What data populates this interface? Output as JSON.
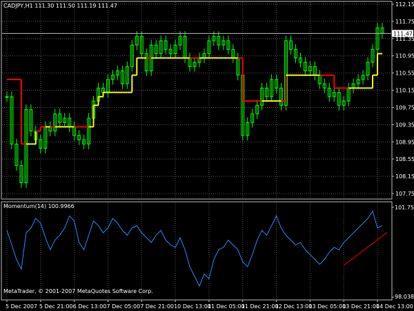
{
  "header": {
    "symbol": "CADJPY,H1",
    "ohlc": "111.30 111.50 111.19 111.47"
  },
  "indicator": {
    "name": "Momentum(14)",
    "value": "100.9966"
  },
  "copyright": "MetaTrader, © 2001-2007 MetaQuotes Software Corp.",
  "colors": {
    "background": "#000000",
    "grid": "#5a5a5a",
    "frame": "#c0c0c0",
    "candles": "#00ff00",
    "line_up": "#ffff00",
    "line_down": "#ff0000",
    "momentum": "#1e90ff",
    "trendline": "#ff0000"
  },
  "chart_data": [
    {
      "type": "line",
      "panel": "price",
      "y_ticks": [
        "112.15",
        "111.75",
        "111.35",
        "110.95",
        "110.55",
        "110.15",
        "109.75",
        "109.35",
        "108.95",
        "108.55",
        "108.15",
        "107.75"
      ],
      "ylim": [
        107.75,
        112.15
      ],
      "current_price": "111.47",
      "x_ticks": [
        "5 Dec 2007",
        "5 Dec 21:00",
        "6 Dec 13:00",
        "7 Dec 05:00",
        "7 Dec 21:00",
        "10 Dec 13:00",
        "11 Dec 05:00",
        "11 Dec 21:00",
        "12 Dec 13:00",
        "13 Dec 05:00",
        "13 Dec 21:00",
        "14 Dec 13:00"
      ],
      "price_close": [
        110.0,
        108.9,
        108.4,
        108.0,
        109.7,
        109.2,
        109.0,
        108.8,
        109.3,
        109.2,
        109.6,
        109.4,
        109.5,
        109.3,
        109.1,
        109.0,
        108.9,
        109.5,
        109.9,
        110.2,
        110.1,
        110.4,
        110.5,
        110.6,
        110.3,
        110.7,
        111.2,
        111.4,
        111.0,
        110.6,
        111.2,
        111.0,
        111.3,
        111.1,
        111.0,
        111.2,
        111.4,
        110.9,
        110.7,
        110.8,
        110.9,
        111.0,
        111.3,
        111.4,
        111.2,
        111.3,
        111.1,
        110.9,
        110.5,
        109.1,
        109.4,
        109.6,
        109.8,
        110.2,
        110.0,
        110.4,
        110.2,
        109.8,
        111.3,
        111.1,
        110.9,
        110.8,
        110.6,
        110.7,
        110.5,
        110.3,
        110.2,
        110.0,
        110.1,
        109.8,
        109.9,
        110.2,
        110.3,
        110.4,
        110.5,
        110.8,
        111.1,
        111.6,
        111.47
      ],
      "support_line": [
        110.4,
        110.4,
        110.4,
        108.9,
        108.9,
        108.9,
        109.2,
        109.3,
        109.3,
        109.3,
        109.3,
        109.3,
        109.3,
        109.3,
        109.3,
        109.3,
        109.3,
        109.3,
        109.8,
        110.0,
        110.1,
        110.1,
        110.1,
        110.1,
        110.1,
        110.1,
        110.5,
        110.9,
        110.9,
        110.9,
        110.9,
        110.9,
        110.9,
        110.9,
        110.9,
        110.9,
        110.9,
        110.9,
        110.9,
        110.9,
        110.9,
        110.9,
        110.9,
        110.9,
        110.9,
        110.9,
        110.9,
        110.9,
        110.9,
        109.9,
        109.9,
        109.9,
        109.9,
        109.9,
        109.9,
        109.9,
        109.9,
        109.9,
        110.5,
        110.5,
        110.5,
        110.5,
        110.5,
        110.5,
        110.5,
        110.5,
        110.5,
        110.5,
        110.2,
        110.2,
        110.2,
        110.2,
        110.2,
        110.2,
        110.2,
        110.2,
        110.5,
        111.0,
        111.0
      ],
      "x_tick_positions": [
        0,
        7,
        14,
        21,
        28,
        35,
        42,
        49,
        56,
        63,
        70,
        77
      ]
    },
    {
      "type": "line",
      "panel": "momentum",
      "series_name": "Momentum(14)",
      "y_ticks": [
        "101.7566",
        "98.0383"
      ],
      "ylim": [
        98.0383,
        101.7566
      ],
      "values": [
        100.8,
        100.2,
        99.6,
        99.2,
        100.7,
        100.9,
        101.3,
        101.1,
        100.5,
        100.0,
        100.4,
        100.6,
        100.9,
        101.4,
        101.2,
        100.3,
        100.0,
        100.6,
        101.2,
        101.0,
        100.7,
        100.9,
        101.3,
        101.1,
        100.8,
        100.6,
        100.9,
        101.0,
        100.7,
        100.5,
        100.3,
        100.6,
        100.8,
        100.4,
        100.2,
        100.1,
        100.5,
        100.0,
        99.3,
        98.9,
        98.5,
        99.0,
        98.8,
        99.6,
        100.0,
        100.1,
        100.4,
        100.2,
        100.0,
        99.5,
        99.3,
        99.8,
        100.4,
        100.8,
        100.6,
        101.0,
        101.4,
        100.9,
        100.6,
        100.4,
        100.2,
        100.3,
        100.0,
        99.8,
        99.6,
        99.4,
        99.6,
        99.9,
        100.1,
        100.0,
        100.3,
        100.5,
        100.7,
        100.9,
        101.1,
        101.3,
        101.6,
        100.9,
        101.0
      ],
      "trendline": [
        [
          70,
          99.35
        ],
        [
          79,
          100.72
        ]
      ]
    }
  ]
}
